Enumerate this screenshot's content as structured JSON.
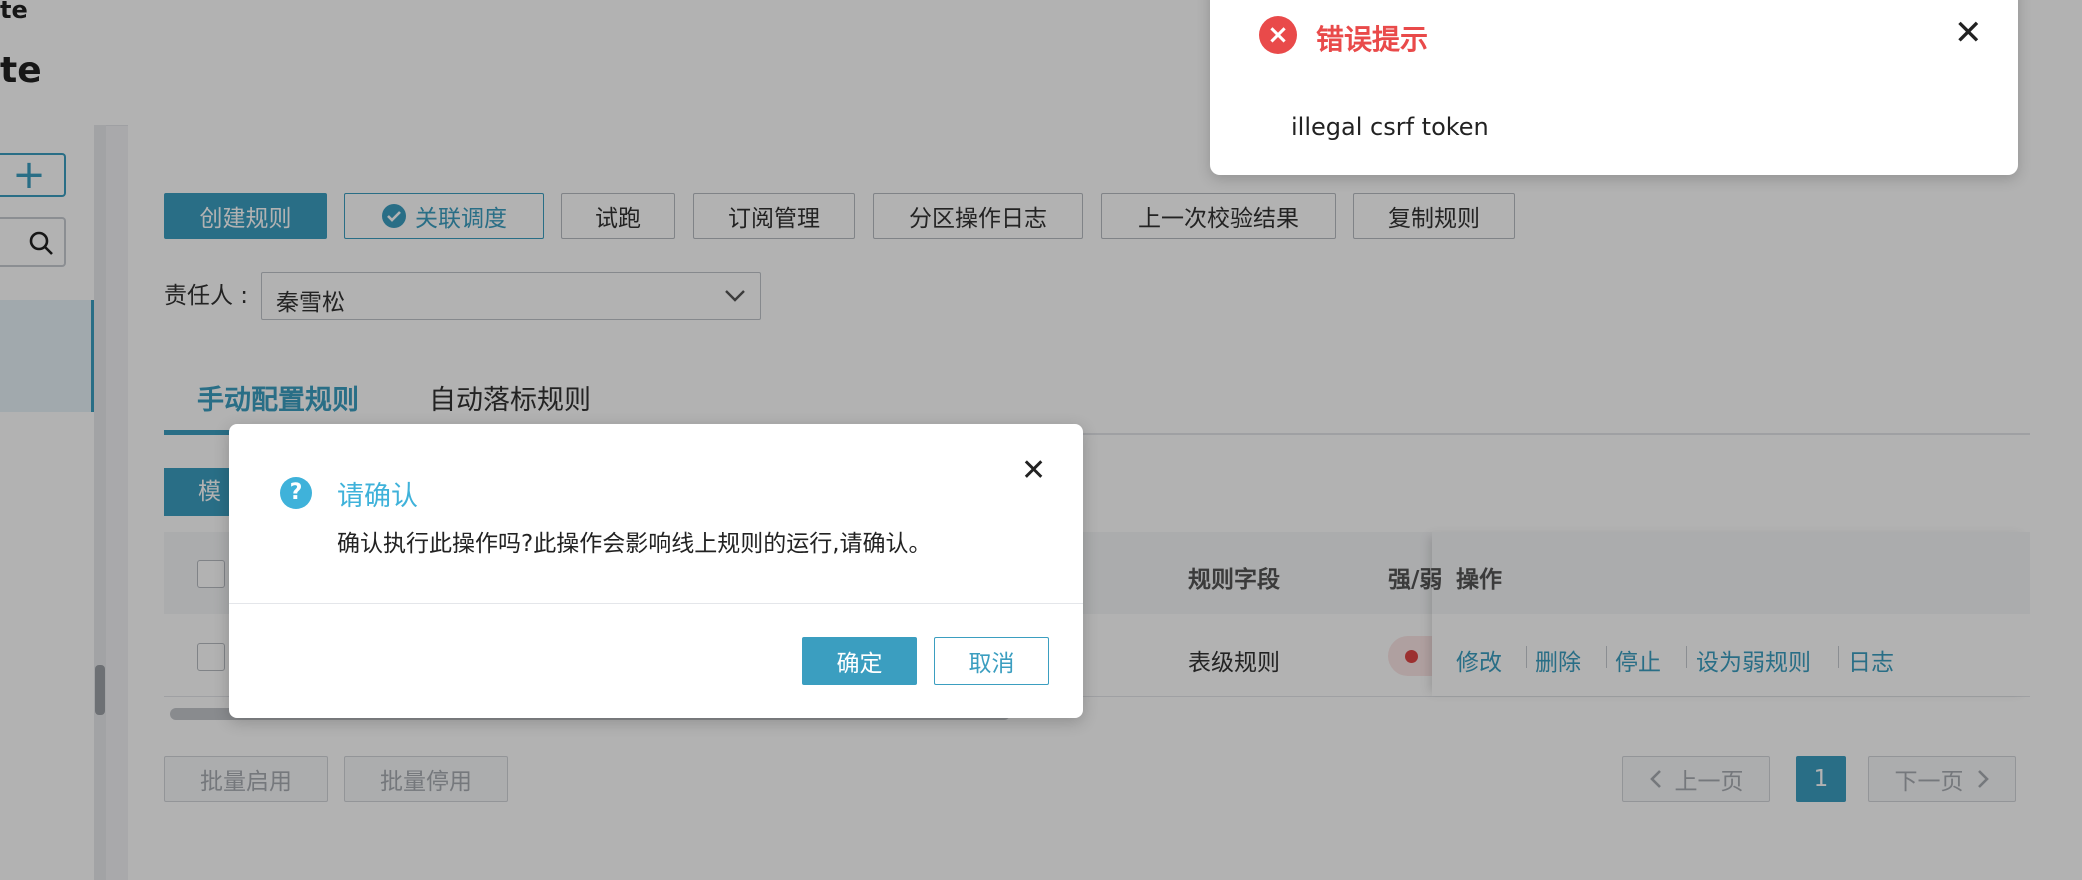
{
  "header": {
    "app_name_small": "te",
    "app_name_big": "te"
  },
  "toolbar": {
    "create_rule": "创建规则",
    "link_schedule": "关联调度",
    "trial_run": "试跑",
    "subscription": "订阅管理",
    "partition_log": "分区操作日志",
    "last_check_result": "上一次校验结果",
    "copy_rule": "复制规则"
  },
  "owner": {
    "label": "责任人 :",
    "value": "秦雪松"
  },
  "tabs": [
    {
      "label": "手动配置规则"
    },
    {
      "label": "自动落标规则"
    }
  ],
  "template_button": "模板",
  "table": {
    "headers": {
      "rule_field": "规则字段",
      "strength": "强/弱",
      "operations": "操作"
    },
    "rows": [
      {
        "rule_field": "表级规则",
        "status": "强"
      }
    ],
    "actions": [
      "修改",
      "删除",
      "停止",
      "设为弱规则",
      "日志"
    ]
  },
  "batch": {
    "enable": "批量启用",
    "disable": "批量停用"
  },
  "pagination": {
    "prev": "上一页",
    "current": "1",
    "next": "下一页"
  },
  "error_toast": {
    "title": "错误提示",
    "message": "illegal csrf token",
    "icon": "error-circle-icon"
  },
  "confirm_dialog": {
    "title": "请确认",
    "message": "确认执行此操作吗?此操作会影响线上规则的运行,请确认。",
    "ok": "确定",
    "cancel": "取消",
    "icon": "question-circle-icon"
  },
  "colors": {
    "primary": "#3b9ec0",
    "danger": "#e94a4a",
    "info": "#3fb2da"
  }
}
